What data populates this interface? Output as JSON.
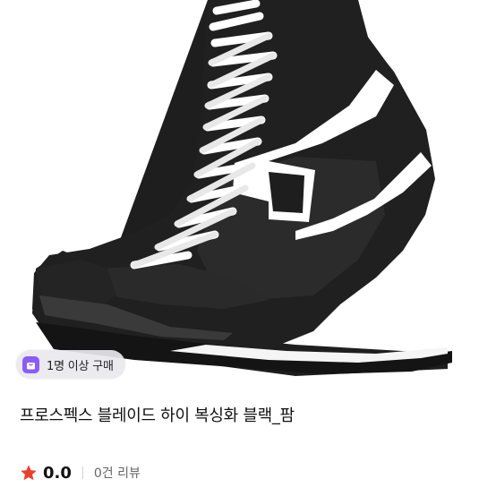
{
  "product": {
    "image_alt": "black high-top boxing shoe with white laces and white side stripes",
    "badge_text": "1명 이상 구매",
    "title": "프로스펙스 블레이드 하이 복싱화 블랙_팜",
    "rating": "0.0",
    "review_count": "0건 리뷰"
  },
  "colors": {
    "badge_icon": "#8b5cf6",
    "star": "#e8402f",
    "shoe": "#1e1e1e",
    "accent": "#ffffff"
  },
  "icons": {
    "badge": "shopping-bag-icon",
    "rating": "star-icon"
  }
}
